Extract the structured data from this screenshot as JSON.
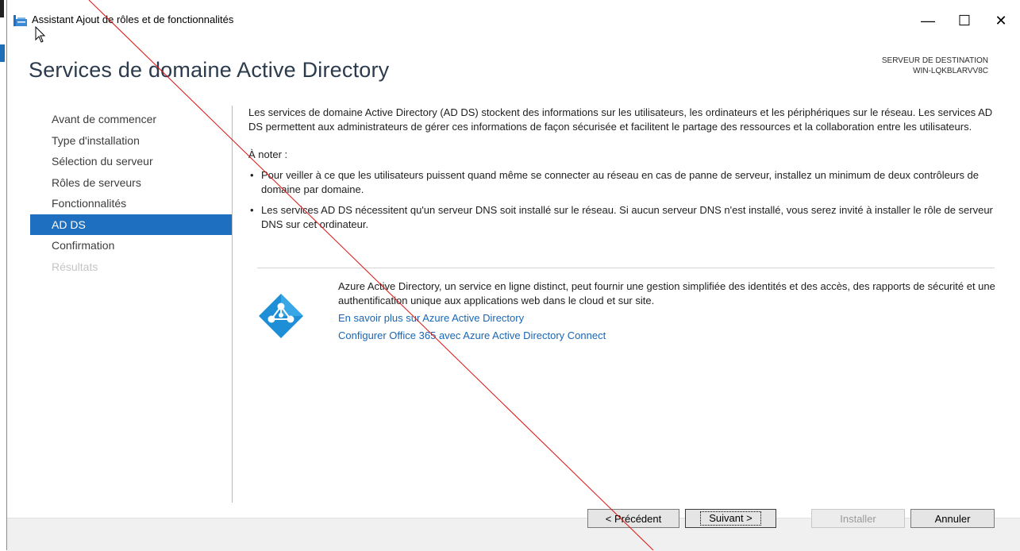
{
  "window": {
    "title": "Assistant Ajout de rôles et de fonctionnalités",
    "controls": {
      "minimize": "—",
      "maximize": "☐",
      "close": "✕"
    }
  },
  "page": {
    "title": "Services de domaine Active Directory",
    "destination_label": "SERVEUR DE DESTINATION",
    "destination_server": "WIN-LQKBLARVV8C"
  },
  "nav": {
    "items": [
      {
        "label": "Avant de commencer",
        "state": "normal"
      },
      {
        "label": "Type d'installation",
        "state": "normal"
      },
      {
        "label": "Sélection du serveur",
        "state": "normal"
      },
      {
        "label": "Rôles de serveurs",
        "state": "normal"
      },
      {
        "label": "Fonctionnalités",
        "state": "normal"
      },
      {
        "label": "AD DS",
        "state": "active"
      },
      {
        "label": "Confirmation",
        "state": "normal"
      },
      {
        "label": "Résultats",
        "state": "disabled"
      }
    ]
  },
  "content": {
    "intro": "Les services de domaine Active Directory (AD DS) stockent des informations sur les utilisateurs, les ordinateurs et les périphériques sur le réseau. Les services AD DS permettent aux administrateurs de gérer ces informations de façon sécurisée et facilitent le partage des ressources et la collaboration entre les utilisateurs.",
    "note_title": "À noter :",
    "bullets": [
      "Pour veiller à ce que les utilisateurs puissent quand même se connecter au réseau en cas de panne de serveur, installez un minimum de deux contrôleurs de domaine par domaine.",
      "Les services AD DS nécessitent qu'un serveur DNS soit installé sur le réseau. Si aucun serveur DNS n'est installé, vous serez invité à installer le rôle de serveur DNS sur cet ordinateur."
    ],
    "azure_text": "Azure Active Directory, un service en ligne distinct, peut fournir une gestion simplifiée des identités et des accès, des rapports de sécurité et une authentification unique aux applications web dans le cloud et sur site.",
    "link_learn": "En savoir plus sur Azure Active Directory",
    "link_configure": "Configurer Office 365 avec Azure Active Directory Connect"
  },
  "buttons": {
    "previous": "< Précédent",
    "next": "Suivant >",
    "install": "Installer",
    "cancel": "Annuler"
  },
  "colors": {
    "accent": "#1e6fc0",
    "link": "#1a66b5",
    "title": "#2b3b4d",
    "annotation_line": "#e01010"
  }
}
